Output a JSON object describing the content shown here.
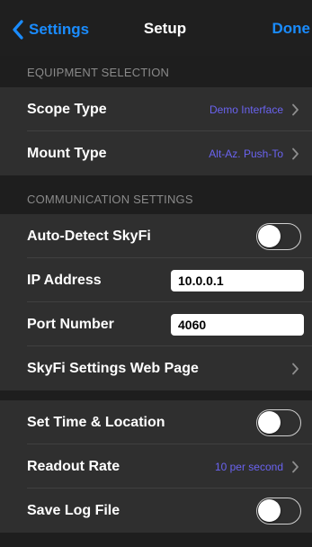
{
  "navbar": {
    "back_label": "Settings",
    "title": "Setup",
    "done_label": "Done"
  },
  "equipment": {
    "header": "EQUIPMENT SELECTION",
    "scope_type": {
      "label": "Scope Type",
      "value": "Demo Interface"
    },
    "mount_type": {
      "label": "Mount Type",
      "value": "Alt-Az. Push-To"
    }
  },
  "communication": {
    "header": "COMMUNICATION SETTINGS",
    "auto_detect": {
      "label": "Auto-Detect SkyFi",
      "enabled": false
    },
    "ip_address": {
      "label": "IP Address",
      "value": "10.0.0.1"
    },
    "port_number": {
      "label": "Port Number",
      "value": "4060"
    },
    "web_page": {
      "label": "SkyFi Settings Web Page"
    }
  },
  "misc": {
    "set_time_location": {
      "label": "Set Time & Location",
      "enabled": false
    },
    "readout_rate": {
      "label": "Readout Rate",
      "value": "10 per second"
    },
    "save_log_file": {
      "label": "Save Log File",
      "enabled": false
    }
  },
  "colors": {
    "accent": "#1a8cff",
    "value_text": "#6a63f0",
    "row_background": "#2f2f2f",
    "page_background": "#1e1e1e",
    "header_text": "#8a8a8a"
  },
  "icons": {
    "back": "chevron-left-icon",
    "disclosure": "chevron-right-icon"
  }
}
